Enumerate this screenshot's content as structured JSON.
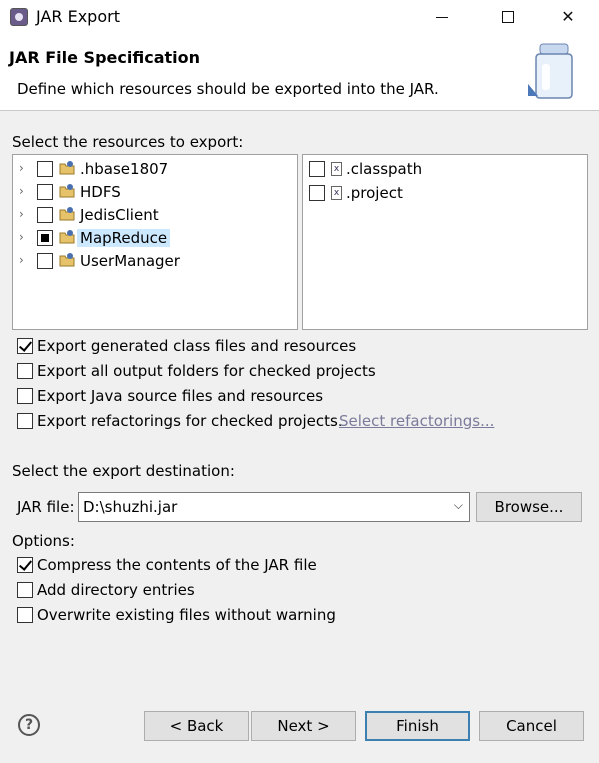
{
  "window": {
    "title": "JAR Export",
    "controls": {
      "minimize": "minimize",
      "maximize": "maximize",
      "close": "✕"
    }
  },
  "header": {
    "title": "JAR File Specification",
    "description": "Define which resources should be exported into the JAR."
  },
  "resources": {
    "label": "Select the resources to export:",
    "projects": [
      {
        "name": ".hbase1807",
        "state": "unchecked",
        "selected": false
      },
      {
        "name": "HDFS",
        "state": "unchecked",
        "selected": false
      },
      {
        "name": "JedisClient",
        "state": "unchecked",
        "selected": false
      },
      {
        "name": "MapReduce",
        "state": "partial",
        "selected": true
      },
      {
        "name": "UserManager",
        "state": "unchecked",
        "selected": false
      }
    ],
    "files": [
      {
        "name": ".classpath",
        "checked": false
      },
      {
        "name": ".project",
        "checked": false
      }
    ]
  },
  "export_options": [
    {
      "label": "Export generated class files and resources",
      "checked": true
    },
    {
      "label": "Export all output folders for checked projects",
      "checked": false
    },
    {
      "label": "Export Java source files and resources",
      "checked": false
    },
    {
      "label": "Export refactorings for checked projects.",
      "checked": false,
      "link": "Select refactorings..."
    }
  ],
  "destination": {
    "label": "Select the export destination:",
    "jar_label": "JAR file:",
    "jar_value": "D:\\shuzhi.jar",
    "browse": "Browse..."
  },
  "options": {
    "label": "Options:",
    "items": [
      {
        "label": "Compress the contents of the JAR file",
        "checked": true
      },
      {
        "label": "Add directory entries",
        "checked": false
      },
      {
        "label": "Overwrite existing files without warning",
        "checked": false
      }
    ]
  },
  "buttons": {
    "back": "< Back",
    "next": "Next >",
    "finish": "Finish",
    "cancel": "Cancel"
  },
  "help_icon": "?",
  "colors": {
    "selection": "#cce8ff",
    "default_button_border": "#3c7fb1",
    "link": "#7a7a9a"
  }
}
